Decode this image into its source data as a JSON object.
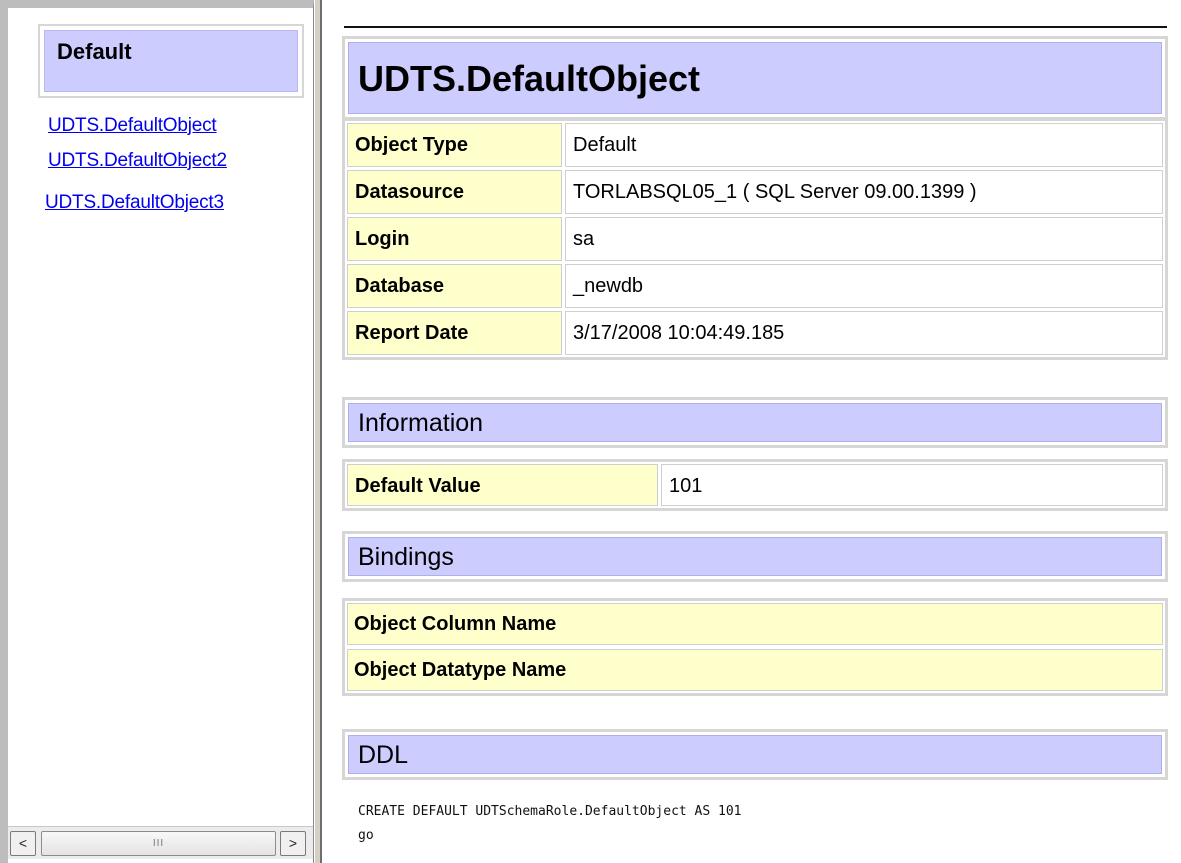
{
  "sidebar": {
    "heading": "Default",
    "links": [
      "UDTS.DefaultObject",
      "UDTS.DefaultObject2",
      "UDTS.DefaultObject3"
    ],
    "scrollbar": {
      "left_glyph": "<",
      "right_glyph": ">",
      "thumb_grip": "III"
    }
  },
  "main": {
    "title": "UDTS.DefaultObject",
    "properties": [
      {
        "label": "Object Type",
        "value": "Default"
      },
      {
        "label": "Datasource",
        "value": "TORLABSQL05_1 ( SQL Server 09.00.1399 )"
      },
      {
        "label": "Login",
        "value": "sa"
      },
      {
        "label": "Database",
        "value": "_newdb"
      },
      {
        "label": "Report Date",
        "value": "3/17/2008 10:04:49.185"
      }
    ],
    "information": {
      "title": "Information",
      "label": "Default Value",
      "value": "101"
    },
    "bindings": {
      "title": "Bindings",
      "columns": [
        "Object Column Name",
        "Object Datatype Name"
      ]
    },
    "ddl": {
      "title": "DDL",
      "code": "CREATE DEFAULT UDTSchemaRole.DefaultObject AS 101\ngo"
    }
  },
  "colors": {
    "title_bg": "#ccccff",
    "label_bg": "#ffffcc",
    "link": "#0000ee",
    "frame": "#d4d0c8"
  }
}
